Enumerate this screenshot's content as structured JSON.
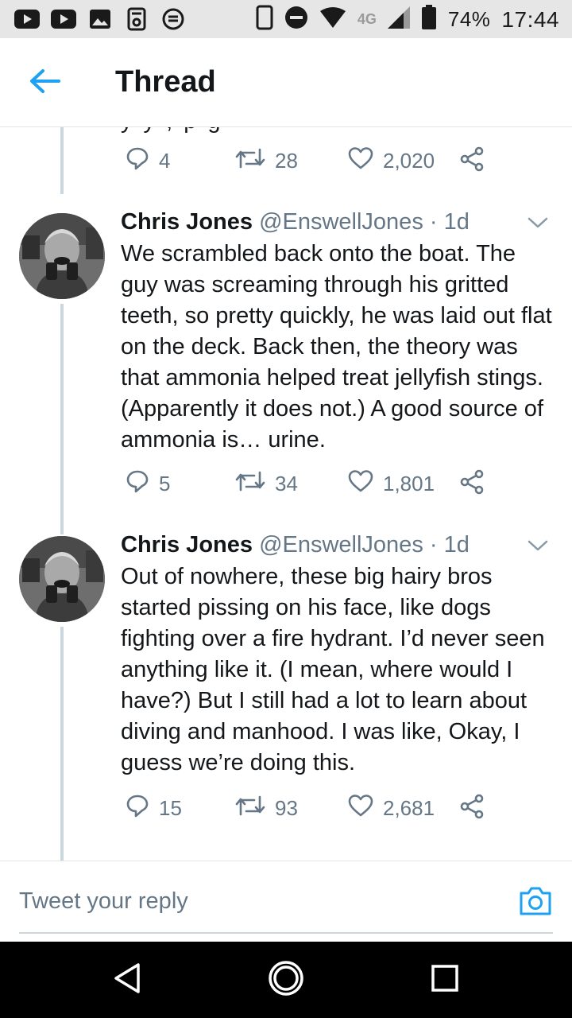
{
  "status_bar": {
    "left_icons": [
      "youtube-icon",
      "youtube-icon",
      "image-icon",
      "lock-icon",
      "sync-icon"
    ],
    "right_icons": [
      "phone-icon",
      "do-not-disturb-icon",
      "wifi-icon",
      "signal-icon",
      "battery-icon"
    ],
    "network": "4G",
    "battery": "74%",
    "time": "17:44"
  },
  "appbar": {
    "back_icon": "arrow-left-icon",
    "title": "Thread",
    "accent": "#1da1f2"
  },
  "prev_tweet": {
    "replies": "4",
    "retweets": "28",
    "likes": "2,020"
  },
  "tweets": [
    {
      "name": "Chris Jones",
      "handle": "@EnswellJones",
      "separator": "·",
      "time": "1d",
      "text": "We scrambled back onto the boat. The guy was screaming through his gritted teeth, so pretty quickly, he was laid out flat on the deck. Back then, the theory was that ammonia helped treat jellyfish stings. (Apparently it does not.) A good source of ammonia is… urine.",
      "replies": "5",
      "retweets": "34",
      "likes": "1,801"
    },
    {
      "name": "Chris Jones",
      "handle": "@EnswellJones",
      "separator": "·",
      "time": "1d",
      "text": "Out of nowhere, these big hairy bros started pissing on his face, like dogs fighting over a fire hydrant. I’d never seen anything like it. (I mean, where would I have?) But I still had a lot to learn about diving and manhood. I was like, Okay, I guess we’re doing this.",
      "replies": "15",
      "retweets": "93",
      "likes": "2,681"
    }
  ],
  "reply_bar": {
    "placeholder": "Tweet your reply",
    "camera_icon": "camera-icon"
  },
  "nav_bar": {
    "icons": [
      "back-triangle-icon",
      "home-circle-icon",
      "recents-square-icon"
    ]
  },
  "colors": {
    "text_primary": "#14171a",
    "text_secondary": "#657786",
    "thread_line": "#ccd6dd",
    "accent": "#1da1f2"
  }
}
